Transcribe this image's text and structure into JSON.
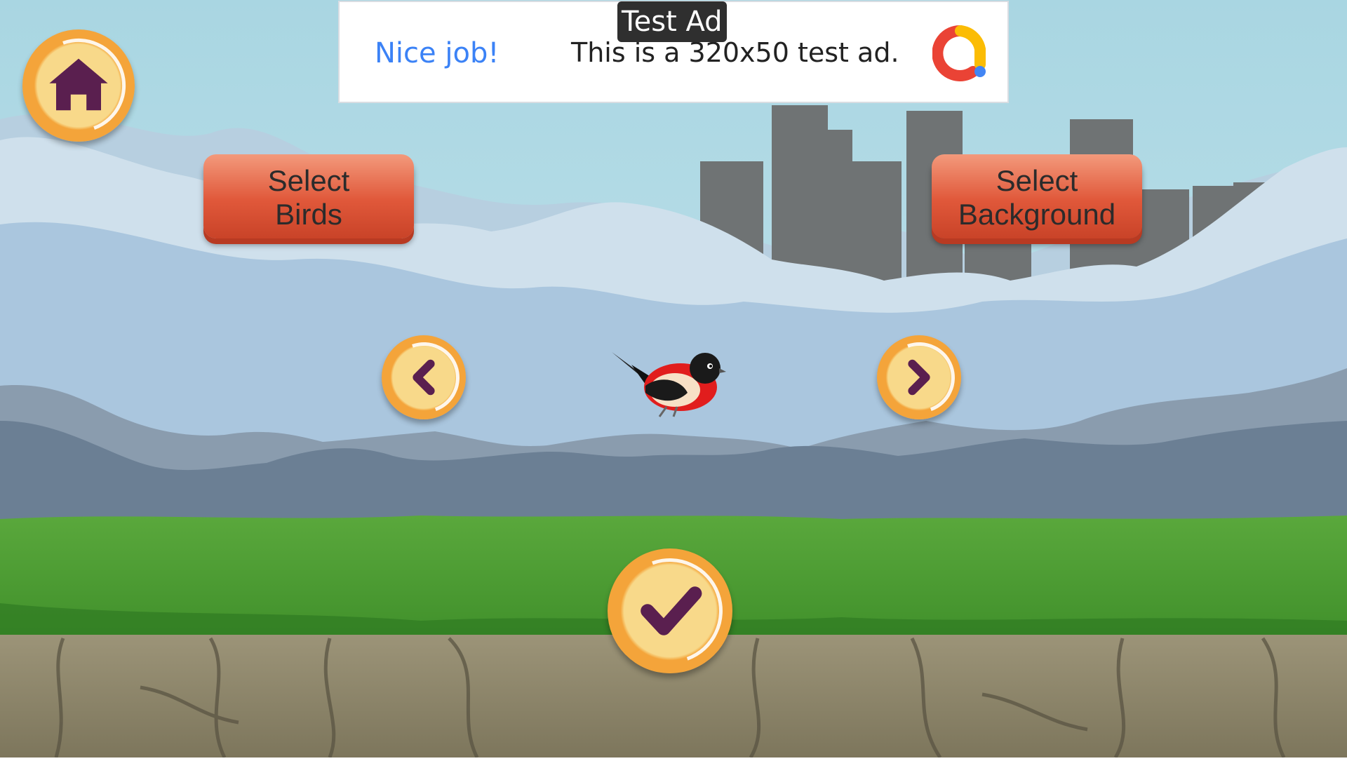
{
  "ad": {
    "badge": "Test Ad",
    "cta": "Nice job!",
    "text": "This is a 320x50 test ad."
  },
  "buttons": {
    "select_birds": "Select\nBirds",
    "select_background": "Select\nBackground"
  },
  "icons": {
    "home": "home-icon",
    "prev": "chevron-left-icon",
    "next": "chevron-right-icon",
    "confirm": "checkmark-icon"
  },
  "colors": {
    "coin_outer": "#f4a43a",
    "coin_inner": "#f8d98a",
    "icon": "#5a1f4f",
    "button": "#e0583a"
  }
}
